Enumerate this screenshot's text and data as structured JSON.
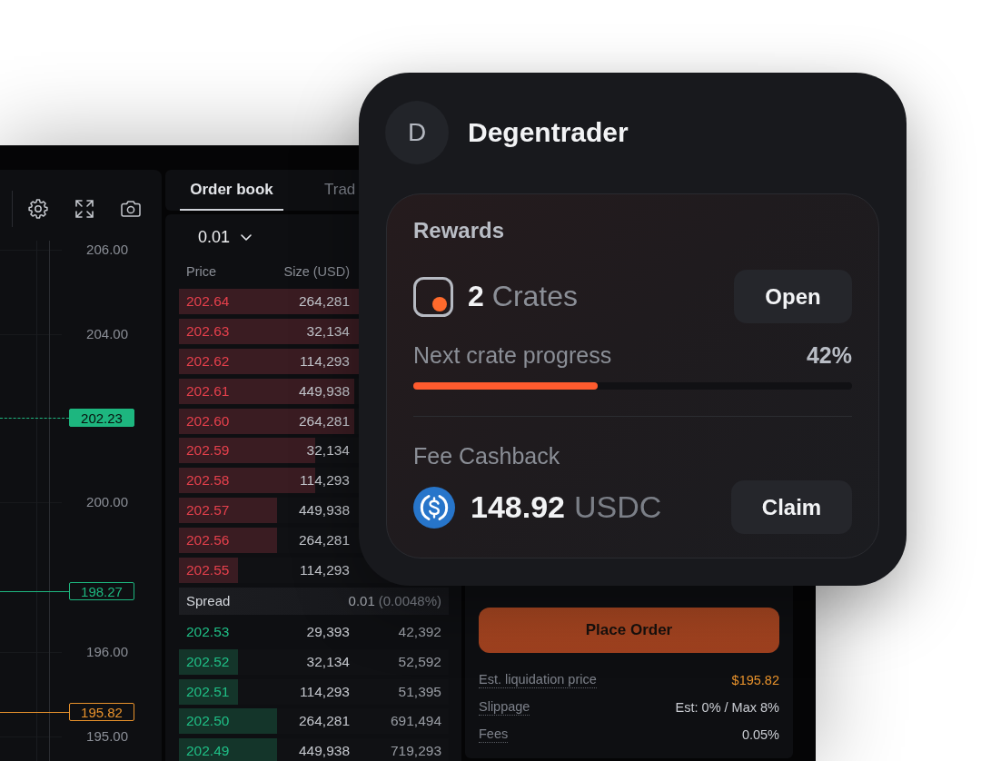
{
  "chart": {
    "price_axis": [
      {
        "kind": "tick",
        "label": "206.00"
      },
      {
        "kind": "tick",
        "label": "204.00"
      },
      {
        "kind": "filled_tag",
        "label": "202.23",
        "color": "#1db67f"
      },
      {
        "kind": "tick",
        "label": "200.00"
      },
      {
        "kind": "outline_tag",
        "label": "198.27",
        "color": "#1db67f"
      },
      {
        "kind": "tick",
        "label": "196.00"
      },
      {
        "kind": "outline_tag",
        "label": "195.82",
        "color": "#e8922c"
      },
      {
        "kind": "tick",
        "label": "195.00"
      }
    ]
  },
  "order_book": {
    "tabs": [
      {
        "label": "Order book",
        "selected": true
      },
      {
        "label": "Trad",
        "selected": false
      }
    ],
    "tick_size": "0.01",
    "columns": [
      "Price",
      "Size (USD)"
    ],
    "asks": [
      {
        "price": "202.64",
        "size": "264,281",
        "level": 0.665
      },
      {
        "price": "202.63",
        "size": "32,134",
        "level": 0.665
      },
      {
        "price": "202.62",
        "size": "114,293",
        "level": 0.665
      },
      {
        "price": "202.61",
        "size": "449,938",
        "level": 0.65
      },
      {
        "price": "202.60",
        "size": "264,281",
        "level": 0.65
      },
      {
        "price": "202.59",
        "size": "32,134",
        "level": 0.505
      },
      {
        "price": "202.58",
        "size": "114,293",
        "level": 0.505
      },
      {
        "price": "202.57",
        "size": "449,938",
        "level": 0.365
      },
      {
        "price": "202.56",
        "size": "264,281",
        "level": 0.365
      },
      {
        "price": "202.55",
        "size": "114,293",
        "level": 0.22
      }
    ],
    "spread": {
      "label": "Spread",
      "value": "0.01",
      "percent": "(0.0048%)"
    },
    "bids": [
      {
        "price": "202.53",
        "size": "29,393",
        "column_3": "42,392"
      },
      {
        "price": "202.52",
        "size": "32,134",
        "column_3": "52,592",
        "level": 0.22
      },
      {
        "price": "202.51",
        "size": "114,293",
        "column_3": "51,395",
        "level": 0.22
      },
      {
        "price": "202.50",
        "size": "264,281",
        "column_3": "691,494",
        "level": 0.365
      },
      {
        "price": "202.49",
        "size": "449,938",
        "column_3": "719,293",
        "level": 0.365
      }
    ]
  },
  "order_form": {
    "submit": "Place Order",
    "details": [
      {
        "label": "Est. liquidation price",
        "value": "$195.82",
        "color": "#e8922c"
      },
      {
        "label": "Slippage",
        "value": "Est: 0% / Max 8%",
        "color": "#c9ccd2"
      },
      {
        "label": "Fees",
        "value": "0.05%",
        "color": "#c9ccd2"
      }
    ]
  },
  "profile": {
    "initial": "D",
    "name": "Degentrader"
  },
  "rewards": {
    "title": "Rewards",
    "crates": {
      "count": "2",
      "unit": "Crates",
      "action": "Open"
    },
    "progress": {
      "label": "Next crate progress",
      "reading": "42%",
      "level": 0.42
    },
    "cashback": {
      "title": "Fee Cashback",
      "amount": "148.92",
      "currency": "USDC",
      "action": "Claim"
    }
  }
}
